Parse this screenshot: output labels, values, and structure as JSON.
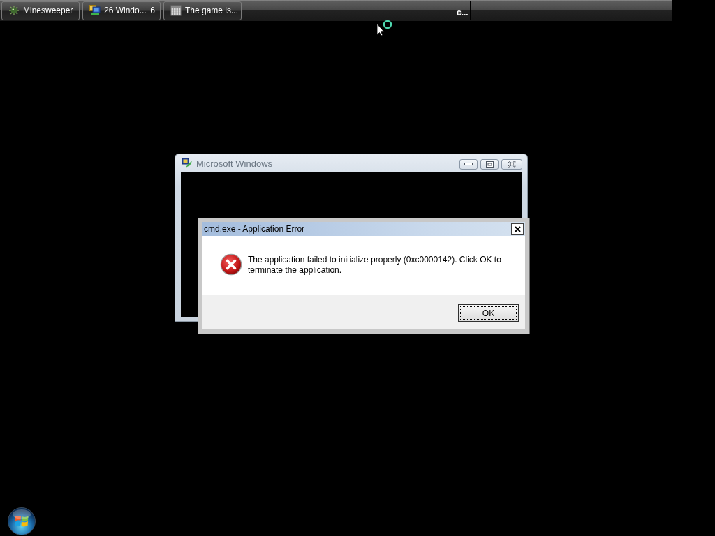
{
  "taskbar": {
    "buttons": [
      {
        "label": "Minesweeper"
      },
      {
        "label": "26 Windo...",
        "count": "6"
      },
      {
        "label": "The game is..."
      }
    ],
    "cut_item": "c..."
  },
  "back_window": {
    "title": "Microsoft Windows"
  },
  "error_dialog": {
    "title": "cmd.exe - Application Error",
    "message": "The application failed to initialize properly (0xc0000142). Click OK to terminate the application.",
    "buttons": [
      "OK"
    ]
  }
}
